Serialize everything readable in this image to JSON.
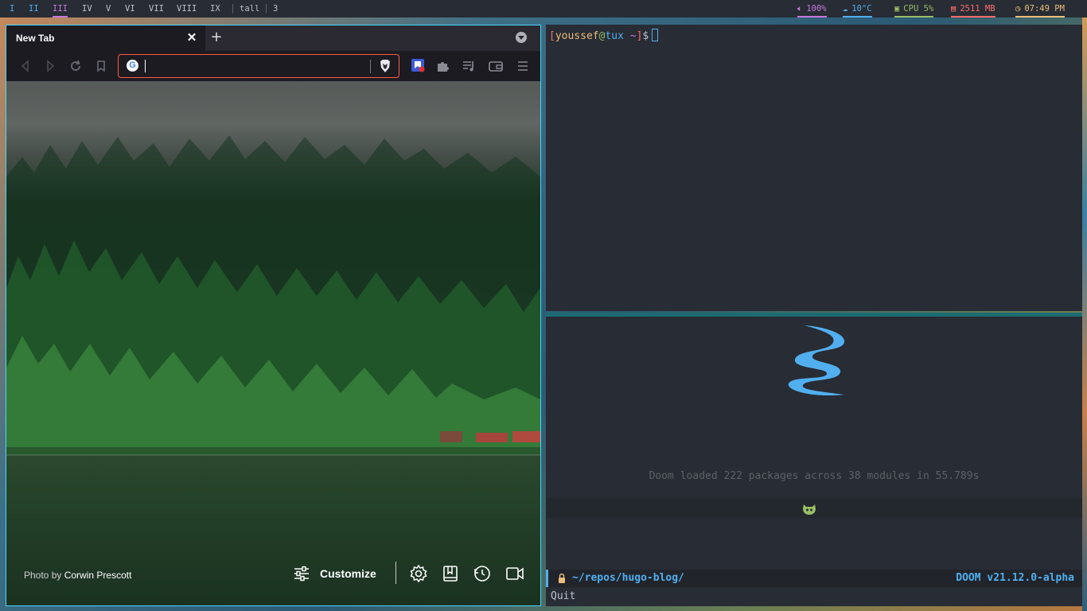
{
  "topbar": {
    "workspaces": [
      "I",
      "II",
      "III",
      "IV",
      "V",
      "VI",
      "VII",
      "VIII",
      "IX"
    ],
    "active_workspace": "III",
    "layout": "tall",
    "window_count": "3",
    "volume": "100%",
    "weather": "10°C",
    "cpu": "CPU 5%",
    "memory": "2511 MB",
    "clock": "07:49 PM"
  },
  "browser": {
    "tab_title": "New Tab",
    "tab_close": "✕",
    "new_tab": "+",
    "google_letter": "G",
    "url_value": "",
    "photo_prefix": "Photo by",
    "photographer": "Corwin Prescott",
    "customize_label": "Customize"
  },
  "terminal": {
    "open_bracket": "[",
    "user": "youssef",
    "at": "@",
    "host": "tux",
    "dir": " ~",
    "close_bracket": "]",
    "prompt_symbol": "$"
  },
  "emacs": {
    "loaded_message": "Doom loaded 222 packages across 38 modules in 55.789s",
    "path": "~/repos/hugo-blog/",
    "version": "DOOM v21.12.0-alpha",
    "minibuffer": "Quit"
  },
  "colors": {
    "bar_bg": "#282c34",
    "accent_purple": "#c678dd",
    "accent_blue": "#51afef",
    "cyan_border": "#46d9ff",
    "url_focus": "#ff5b41",
    "volume_color": "#c678dd",
    "weather_color": "#51afef",
    "cpu_color": "#98be65",
    "memory_color": "#ff6c6b",
    "clock_color": "#ecbe7b"
  }
}
